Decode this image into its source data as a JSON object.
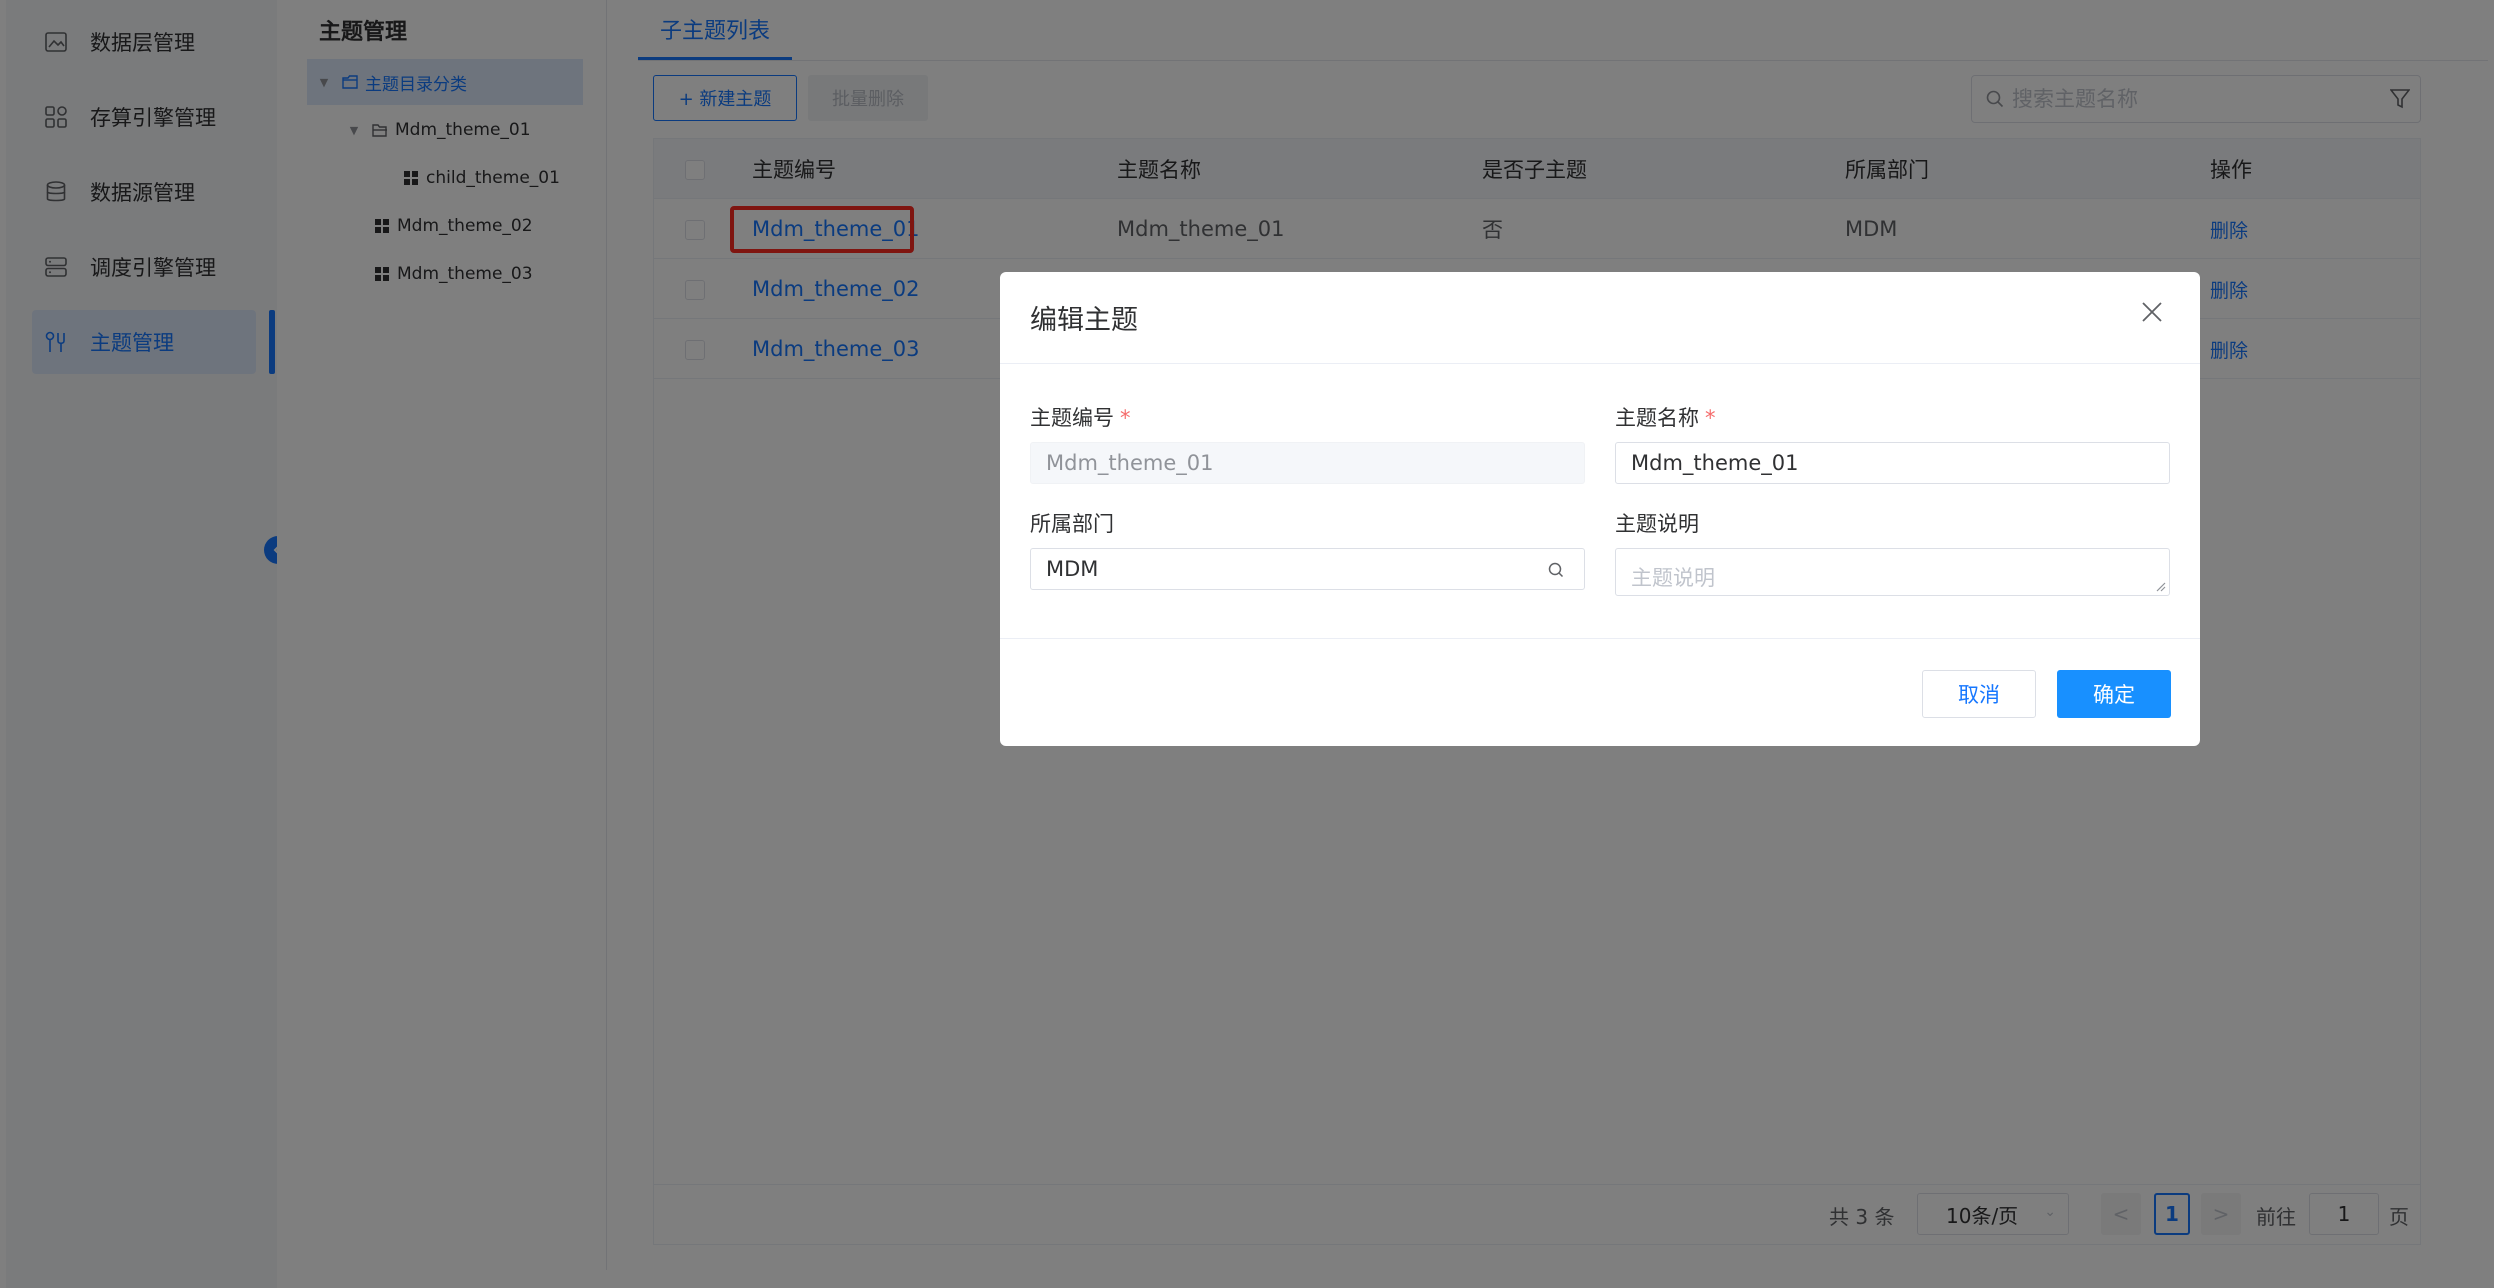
{
  "nav": {
    "items": [
      {
        "label": "数据层管理",
        "icon": "image-icon"
      },
      {
        "label": "存算引擎管理",
        "icon": "grid-icon"
      },
      {
        "label": "数据源管理",
        "icon": "database-icon"
      },
      {
        "label": "调度引擎管理",
        "icon": "server-icon"
      },
      {
        "label": "主题管理",
        "icon": "theme-icon"
      }
    ],
    "active_index": 4
  },
  "tree": {
    "title": "主题管理",
    "nodes": [
      {
        "label": "主题目录分类"
      },
      {
        "label": "Mdm_theme_01"
      },
      {
        "label": "child_theme_01"
      },
      {
        "label": "Mdm_theme_02"
      },
      {
        "label": "Mdm_theme_03"
      }
    ]
  },
  "main": {
    "tab_label": "子主题列表",
    "new_button": "+ 新建主题",
    "batch_delete_button": "批量删除",
    "search_placeholder": "搜索主题名称",
    "columns": [
      "主题编号",
      "主题名称",
      "是否子主题",
      "所属部门",
      "操作"
    ],
    "rows": [
      {
        "code": "Mdm_theme_01",
        "name": "Mdm_theme_01",
        "is_child": "否",
        "dept": "MDM",
        "op": "删除"
      },
      {
        "code": "Mdm_theme_02",
        "op": "删除"
      },
      {
        "code": "Mdm_theme_03",
        "op": "删除"
      }
    ],
    "pager": {
      "total": "共 3 条",
      "page_size": "10条/页",
      "prev": "<",
      "current": "1",
      "next": ">",
      "goto_label": "前往",
      "goto_value": "1",
      "page_suffix": "页"
    }
  },
  "modal": {
    "title": "编辑主题",
    "fields": {
      "code_label": "主题编号",
      "code_value": "Mdm_theme_01",
      "name_label": "主题名称",
      "name_value": "Mdm_theme_01",
      "dept_label": "所属部门",
      "dept_value": "MDM",
      "desc_label": "主题说明",
      "desc_placeholder": "主题说明",
      "required_mark": "*"
    },
    "cancel_button": "取消",
    "confirm_button": "确定"
  },
  "colors": {
    "primary": "#1677ff",
    "highlight_border": "#ff2a20",
    "required": "#f56c6c"
  }
}
